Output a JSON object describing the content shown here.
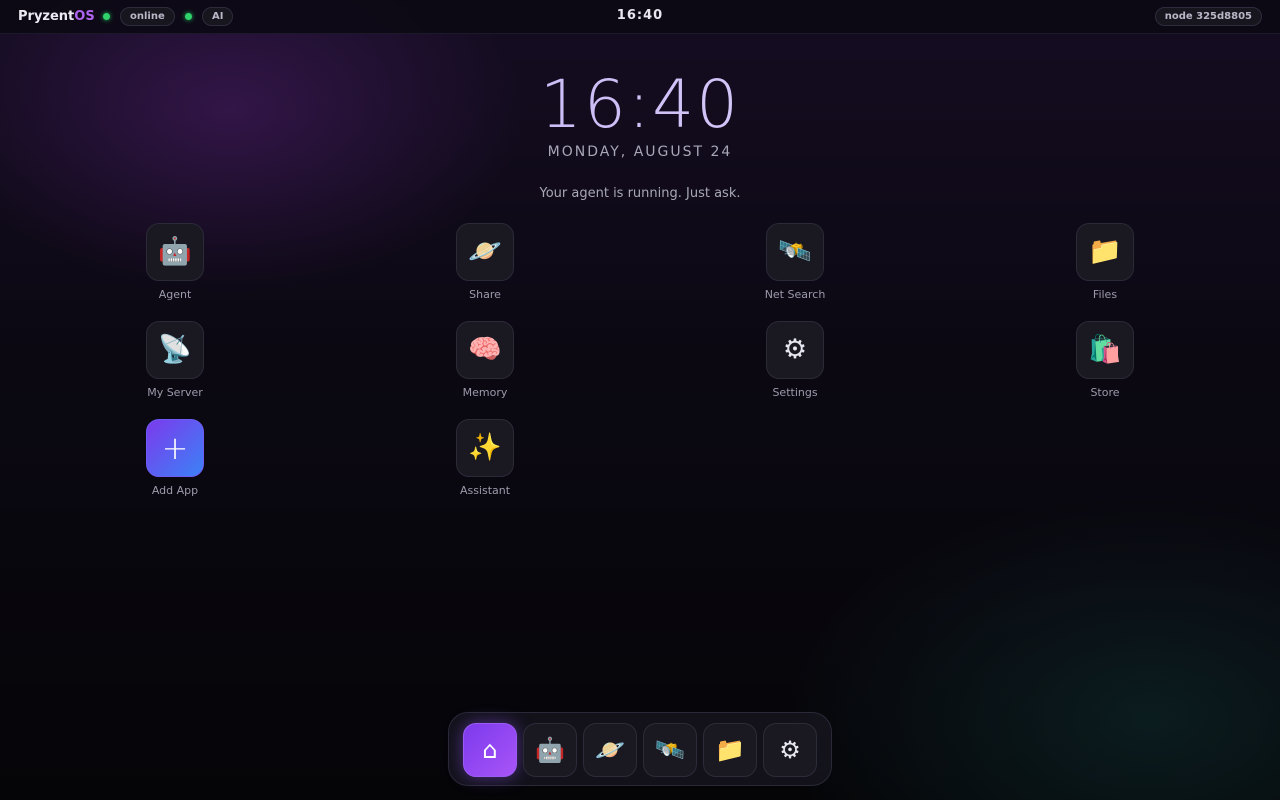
{
  "topbar": {
    "brand_main": "Pryzent",
    "brand_os": "OS",
    "status_online": "online",
    "status_ai": "AI",
    "clock": "16:40",
    "node": "node 325d8805"
  },
  "home": {
    "time": "16:40",
    "date": "MONDAY, AUGUST 24",
    "tagline": "Your agent is running. Just ask."
  },
  "apps": [
    {
      "label": "Agent",
      "icon": "🤖",
      "icon_name": "robot-icon"
    },
    {
      "label": "Share",
      "icon": "🪐",
      "icon_name": "planet-icon"
    },
    {
      "label": "Net Search",
      "icon": "🛰️",
      "icon_name": "satellite-icon"
    },
    {
      "label": "Files",
      "icon": "📁",
      "icon_name": "folder-icon"
    },
    {
      "label": "My Server",
      "icon": "📡",
      "icon_name": "satellite-dish-icon"
    },
    {
      "label": "Memory",
      "icon": "🧠",
      "icon_name": "brain-icon"
    },
    {
      "label": "Settings",
      "icon": "⚙",
      "icon_name": "gear-icon"
    },
    {
      "label": "Store",
      "icon": "🛍️",
      "icon_name": "shopping-bags-icon"
    },
    {
      "label": "Add App",
      "icon": "+",
      "icon_name": "plus-icon"
    },
    {
      "label": "Assistant",
      "icon": "✨",
      "icon_name": "sparkles-icon"
    }
  ],
  "dock": [
    {
      "icon": "⌂",
      "icon_name": "home-icon"
    },
    {
      "icon": "🤖",
      "icon_name": "robot-icon"
    },
    {
      "icon": "🪐",
      "icon_name": "planet-icon"
    },
    {
      "icon": "🛰️",
      "icon_name": "satellite-icon"
    },
    {
      "icon": "📁",
      "icon_name": "folder-icon"
    },
    {
      "icon": "⚙",
      "icon_name": "gear-icon"
    }
  ],
  "colors": {
    "accent_purple": "#a855f7",
    "accent_blue": "#3b82f6",
    "status_green": "#22c55e"
  }
}
